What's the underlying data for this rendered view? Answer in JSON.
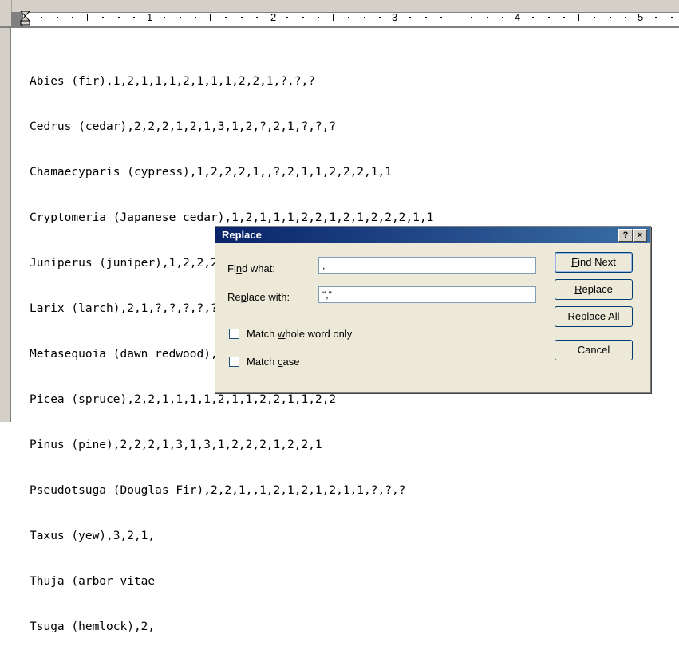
{
  "ruler": {
    "numbers": [
      "1",
      "2",
      "3",
      "4",
      "5"
    ]
  },
  "document": {
    "lines": [
      "Abies (fir),1,2,1,1,1,2,1,1,1,2,2,1,?,?,?",
      "Cedrus (cedar),2,2,2,1,2,1,3,1,2,?,2,1,?,?,?",
      "Chamaecyparis (cypress),1,2,2,2,1,,?,2,1,1,2,2,2,1,1",
      "Cryptomeria (Japanese cedar),1,2,1,1,1,2,2,1,2,1,2,2,2,1,1",
      "Juniperus (juniper),1,2,2,2,1,1,3,1,1,2,2,2,2,1,1",
      "Larix (larch),2,1,?,?,?,?,?,?,1,2,2,?,2,2,2",
      "Metasequoia (dawn redwood),1,1,?,?,?,?,?,?,1,2,2,?,1,1,2",
      "Picea (spruce),2,2,1,1,1,1,2,1,1,2,2,1,1,2,2",
      "Pinus (pine),2,2,2,1,3,1,3,1,2,2,2,1,2,2,1",
      "Pseudotsuga (Douglas Fir),2,2,1,,1,2,1,2,1,2,1,1,?,?,?",
      "Taxus (yew),3,2,1,",
      "Thuja (arbor vitae",
      "Tsuga (hemlock),2,"
    ]
  },
  "dialog": {
    "title": "Replace",
    "help_button": "?",
    "close_button": "×",
    "find_label_pre": "Fi",
    "find_label_u": "n",
    "find_label_post": "d what:",
    "find_value": ",",
    "replace_label_pre": "Re",
    "replace_label_u": "p",
    "replace_label_post": "lace with:",
    "replace_value": "\",\"",
    "find_next_u": "F",
    "find_next_rest": "ind Next",
    "replace_u": "R",
    "replace_rest": "eplace",
    "replace_all_pre": "Replace ",
    "replace_all_u": "A",
    "replace_all_post": "ll",
    "cancel": "Cancel",
    "whole_word_pre": "Match ",
    "whole_word_u": "w",
    "whole_word_post": "hole word only",
    "match_case_pre": "Match ",
    "match_case_u": "c",
    "match_case_post": "ase"
  }
}
